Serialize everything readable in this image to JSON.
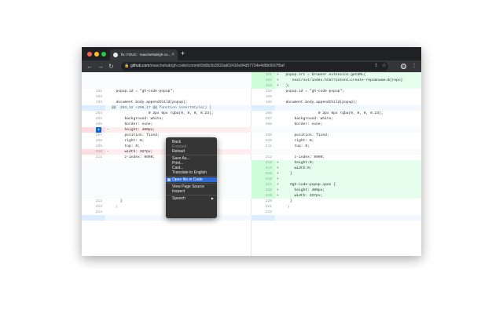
{
  "browser": {
    "tab_title": "fix: FOUC - maxchehab/gh-co…",
    "tab_close": "×",
    "new_tab": "+",
    "nav": {
      "back": "←",
      "forward": "→",
      "reload": "↻"
    },
    "lock": "🔒",
    "url_host": "github.com",
    "url_path": "/maxchehab/gh-code/commit/9d0b3b3502ad02410e84d57734e4d8b0697f9af",
    "icons": {
      "share": "⇪",
      "bookmark": "☆",
      "menu": "⋮"
    }
  },
  "diff": {
    "hunk_header": "@@ -203,12 +206,17 @@ function insertStyle() {",
    "left": [
      {
        "ln": "",
        "mk": "",
        "code": "",
        "type": "empty"
      },
      {
        "ln": "",
        "mk": "",
        "code": "",
        "type": "empty"
      },
      {
        "ln": "",
        "mk": "",
        "code": "",
        "type": "empty"
      },
      {
        "ln": "151",
        "mk": "",
        "code": "  popup.id = \"gh-code-popup\";",
        "type": "ctx"
      },
      {
        "ln": "152",
        "mk": "",
        "code": "",
        "type": "ctx"
      },
      {
        "ln": "153",
        "mk": "",
        "code": "  document.body.appendChild(popup);",
        "type": "ctx"
      },
      {
        "ln": "",
        "mk": "",
        "code": "",
        "type": "hunk"
      },
      {
        "ln": "203",
        "mk": "",
        "code": "                 0 3px 6px rgba(0, 0, 0, 0.23);",
        "type": "ctx"
      },
      {
        "ln": "204",
        "mk": "",
        "code": "      background: white;",
        "type": "ctx"
      },
      {
        "ln": "205",
        "mk": "",
        "code": "      border: none;",
        "type": "ctx"
      },
      {
        "ln": "206",
        "mk": "-",
        "code": "      height: 400px;",
        "type": "del"
      },
      {
        "ln": "207",
        "mk": "",
        "code": "      position: fixed;",
        "type": "ctx"
      },
      {
        "ln": "208",
        "mk": "",
        "code": "      right: 0;",
        "type": "ctx"
      },
      {
        "ln": "209",
        "mk": "",
        "code": "      top: 0;",
        "type": "ctx"
      },
      {
        "ln": "210",
        "mk": "-",
        "code": "      width: 327px;",
        "type": "del"
      },
      {
        "ln": "211",
        "mk": "",
        "code": "      z-index: 9999;",
        "type": "ctx"
      },
      {
        "ln": "",
        "mk": "",
        "code": "",
        "type": "empty"
      },
      {
        "ln": "",
        "mk": "",
        "code": "",
        "type": "empty"
      },
      {
        "ln": "",
        "mk": "",
        "code": "",
        "type": "empty"
      },
      {
        "ln": "",
        "mk": "",
        "code": "",
        "type": "empty"
      },
      {
        "ln": "",
        "mk": "",
        "code": "",
        "type": "empty"
      },
      {
        "ln": "",
        "mk": "",
        "code": "",
        "type": "empty"
      },
      {
        "ln": "",
        "mk": "",
        "code": "",
        "type": "empty"
      },
      {
        "ln": "212",
        "mk": "",
        "code": "    }",
        "type": "ctx"
      },
      {
        "ln": "213",
        "mk": "",
        "code": "  ;",
        "type": "ctx"
      },
      {
        "ln": "214",
        "mk": "",
        "code": "",
        "type": "ctx"
      },
      {
        "ln": "",
        "mk": "",
        "code": "",
        "type": "hunk"
      }
    ],
    "right": [
      {
        "ln": "151",
        "mk": "+",
        "code": "  popup.src = browser.extension.getURL(",
        "type": "add"
      },
      {
        "ln": "152",
        "mk": "+",
        "code": "    `next/out/index.html?intent=create-repo&name=${repo}`",
        "type": "add"
      },
      {
        "ln": "153",
        "mk": "+",
        "code": "  );",
        "type": "add"
      },
      {
        "ln": "154",
        "mk": "",
        "code": "  popup.id = \"gh-code-popup\";",
        "type": "ctx"
      },
      {
        "ln": "155",
        "mk": "",
        "code": "",
        "type": "ctx"
      },
      {
        "ln": "156",
        "mk": "",
        "code": "  document.body.appendChild(popup);",
        "type": "ctx"
      },
      {
        "ln": "",
        "mk": "",
        "code": "",
        "type": "hunk"
      },
      {
        "ln": "206",
        "mk": "",
        "code": "                 0 3px 6px rgba(0, 0, 0, 0.23);",
        "type": "ctx"
      },
      {
        "ln": "207",
        "mk": "",
        "code": "      background: white;",
        "type": "ctx"
      },
      {
        "ln": "208",
        "mk": "",
        "code": "      border: none;",
        "type": "ctx"
      },
      {
        "ln": "",
        "mk": "",
        "code": "",
        "type": "empty"
      },
      {
        "ln": "209",
        "mk": "",
        "code": "      position: fixed;",
        "type": "ctx"
      },
      {
        "ln": "210",
        "mk": "",
        "code": "      right: 0;",
        "type": "ctx"
      },
      {
        "ln": "211",
        "mk": "",
        "code": "      top: 0;",
        "type": "ctx"
      },
      {
        "ln": "",
        "mk": "",
        "code": "",
        "type": "empty"
      },
      {
        "ln": "212",
        "mk": "",
        "code": "      z-index: 9999;",
        "type": "ctx"
      },
      {
        "ln": "213",
        "mk": "+",
        "code": "      height:0;",
        "type": "add"
      },
      {
        "ln": "214",
        "mk": "+",
        "code": "      width:0;",
        "type": "add"
      },
      {
        "ln": "215",
        "mk": "+",
        "code": "    }",
        "type": "add"
      },
      {
        "ln": "216",
        "mk": "+",
        "code": "",
        "type": "add"
      },
      {
        "ln": "217",
        "mk": "+",
        "code": "    #gh-code-popup.open {",
        "type": "add"
      },
      {
        "ln": "218",
        "mk": "+",
        "code": "      height: 400px;",
        "type": "add"
      },
      {
        "ln": "219",
        "mk": "+",
        "code": "      width: 327px;",
        "type": "add"
      },
      {
        "ln": "220",
        "mk": "",
        "code": "    }",
        "type": "ctx"
      },
      {
        "ln": "221",
        "mk": "",
        "code": "  `;",
        "type": "ctx"
      },
      {
        "ln": "222",
        "mk": "",
        "code": "",
        "type": "ctx"
      },
      {
        "ln": "",
        "mk": "",
        "code": "",
        "type": "hunk"
      }
    ],
    "add_comment_label": "+"
  },
  "context_menu": {
    "items": [
      {
        "label": "Back",
        "state": "normal",
        "name": "menu-item-back"
      },
      {
        "label": "Forward",
        "state": "disabled",
        "name": "menu-item-forward"
      },
      {
        "label": "Reload",
        "state": "normal",
        "name": "menu-item-reload"
      },
      {
        "sep": true
      },
      {
        "label": "Save As...",
        "state": "normal",
        "name": "menu-item-save-as"
      },
      {
        "label": "Print...",
        "state": "normal",
        "name": "menu-item-print"
      },
      {
        "label": "Cast...",
        "state": "normal",
        "name": "menu-item-cast"
      },
      {
        "label": "Translate to English",
        "state": "normal",
        "name": "menu-item-translate"
      },
      {
        "sep": true
      },
      {
        "label": "Open file in Code",
        "state": "highlight",
        "name": "menu-item-open-in-code",
        "icon": true
      },
      {
        "sep": true
      },
      {
        "label": "View Page Source",
        "state": "normal",
        "name": "menu-item-view-source"
      },
      {
        "label": "Inspect",
        "state": "normal",
        "name": "menu-item-inspect"
      },
      {
        "sep": true
      },
      {
        "label": "Speech",
        "state": "normal",
        "name": "menu-item-speech",
        "submenu": true
      }
    ],
    "submenu_arrow": "▶"
  },
  "colors": {
    "added_bg": "#e6ffed",
    "deleted_bg": "#ffeef0",
    "hunk_bg": "#f1f8ff",
    "menu_bg": "#353535",
    "menu_highlight": "#2f6bd6",
    "chrome_dark": "#202124"
  }
}
